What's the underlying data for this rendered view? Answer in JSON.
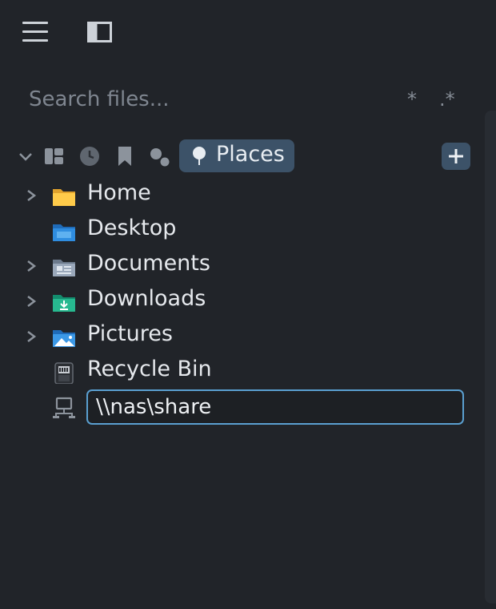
{
  "toolbar": {
    "menu_icon": "hamburger-icon",
    "panel_icon": "sidebar-toggle-icon"
  },
  "search": {
    "placeholder": "Search files...",
    "value": "",
    "wildcard_label": "*",
    "regex_label": ".*"
  },
  "tabs": {
    "collapse_icon": "chevron-down-icon",
    "items": [
      {
        "icon": "dashboard-icon",
        "label": ""
      },
      {
        "icon": "clock-icon",
        "label": ""
      },
      {
        "icon": "bookmark-icon",
        "label": ""
      },
      {
        "icon": "circles-icon",
        "label": ""
      },
      {
        "icon": "pin-icon",
        "label": "Places",
        "active": true
      }
    ],
    "add_label": "+"
  },
  "places": [
    {
      "label": "Home",
      "icon": "folder-home-icon",
      "expandable": true
    },
    {
      "label": "Desktop",
      "icon": "folder-desktop-icon",
      "expandable": false
    },
    {
      "label": "Documents",
      "icon": "folder-documents-icon",
      "expandable": true
    },
    {
      "label": "Downloads",
      "icon": "folder-downloads-icon",
      "expandable": true
    },
    {
      "label": "Pictures",
      "icon": "folder-pictures-icon",
      "expandable": true
    },
    {
      "label": "Recycle Bin",
      "icon": "recycle-bin-icon",
      "expandable": false
    }
  ],
  "new_place": {
    "icon": "network-drive-icon",
    "value": "\\\\nas\\share"
  },
  "colors": {
    "background": "#212429",
    "accent": "#3c5268",
    "focus_border": "#5a9fd0"
  }
}
